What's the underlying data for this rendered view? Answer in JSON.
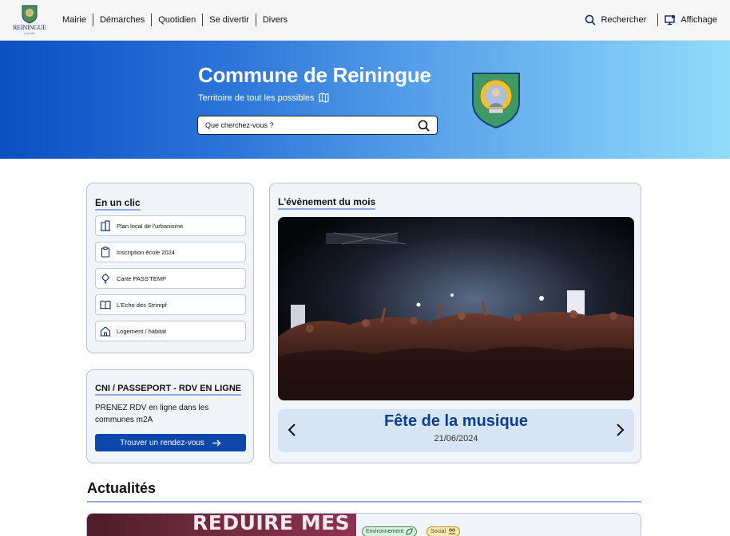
{
  "header": {
    "logo_text": "REININGUE",
    "logo_subtext": "ma ville",
    "nav": [
      "Mairie",
      "Démarches",
      "Quotidien",
      "Se divertir",
      "Divers"
    ],
    "search_label": "Rechercher",
    "display_label": "Affichage"
  },
  "hero": {
    "title": "Commune de Reiningue",
    "subtitle": "Territoire de tout les possibles",
    "search_placeholder": "Que cherchez-vous ?"
  },
  "quick_links": {
    "title": "En un clic",
    "items": [
      {
        "label": "Plan local de l'urbanisme",
        "icon": "buildings-icon"
      },
      {
        "label": "Inscription école 2024",
        "icon": "clipboard-icon"
      },
      {
        "label": "Carte PASS'TEMP",
        "icon": "lightbulb-icon"
      },
      {
        "label": "L'Echo des Strimpf",
        "icon": "book-icon"
      },
      {
        "label": "Logement / habitat",
        "icon": "house-icon"
      }
    ]
  },
  "cni": {
    "title": "CNI / PASSEPORT - RDV EN LIGNE",
    "text": "PRENEZ RDV en ligne dans les communes m2A",
    "button": "Trouver un rendez-vous"
  },
  "event": {
    "title": "L'évènement du mois",
    "name": "Fête de la musique",
    "date": "21/06/2024"
  },
  "news": {
    "title": "Actualités",
    "image_text": "REDUIRE MES",
    "tags": [
      "Environnement",
      "Social"
    ]
  },
  "colors": {
    "primary": "#0d47ab",
    "hero_start": "#0b4fc2",
    "hero_end": "#8fdcfb",
    "card_bg": "#f1f4f9",
    "underline": "#8faadc"
  }
}
